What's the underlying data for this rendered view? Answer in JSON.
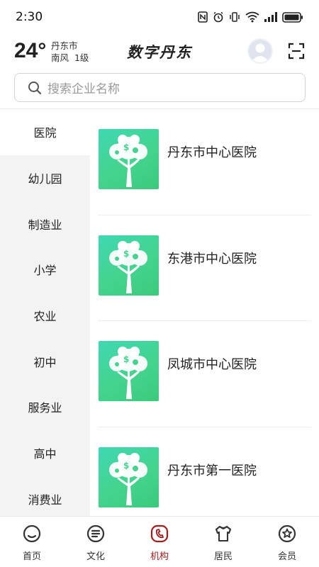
{
  "status_bar": {
    "time": "2:30"
  },
  "header": {
    "temperature": "24°",
    "city": "丹东市",
    "wind": "南风  1级",
    "title": "数字丹东"
  },
  "search": {
    "placeholder": "搜索企业名称"
  },
  "sidebar": {
    "items": [
      {
        "label": "医院",
        "active": true
      },
      {
        "label": "幼儿园"
      },
      {
        "label": "制造业"
      },
      {
        "label": "小学"
      },
      {
        "label": "农业"
      },
      {
        "label": "初中"
      },
      {
        "label": "服务业"
      },
      {
        "label": "高中"
      },
      {
        "label": "消费业"
      }
    ]
  },
  "organizations": [
    {
      "name": "丹东市中心医院"
    },
    {
      "name": "东港市中心医院"
    },
    {
      "name": "凤城市中心医院"
    },
    {
      "name": "丹东市第一医院"
    }
  ],
  "tabbar": {
    "tabs": [
      {
        "label": "首页",
        "icon": "home-icon"
      },
      {
        "label": "文化",
        "icon": "culture-icon"
      },
      {
        "label": "机构",
        "icon": "institution-icon",
        "active": true
      },
      {
        "label": "居民",
        "icon": "resident-icon"
      },
      {
        "label": "会员",
        "icon": "member-icon"
      }
    ]
  },
  "colors": {
    "accent": "#a41c1c",
    "thumb_green": "#44d48e",
    "sidebar_bg": "#f3f3f3"
  }
}
